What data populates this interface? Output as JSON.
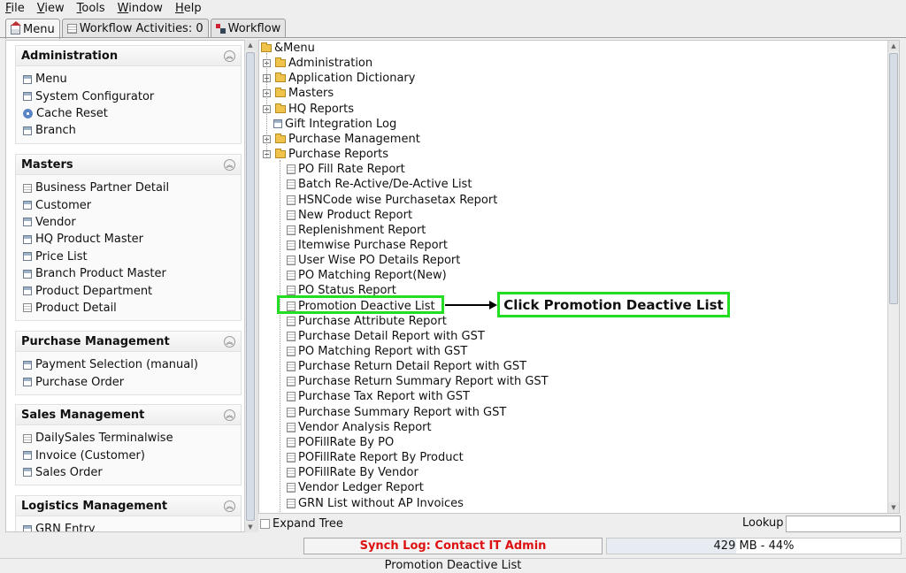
{
  "menubar": [
    "File",
    "View",
    "Tools",
    "Window",
    "Help"
  ],
  "tabs": [
    {
      "label": "Menu",
      "icon": "home-icon"
    },
    {
      "label": "Workflow Activities: 0",
      "icon": "grid-icon"
    },
    {
      "label": "Workflow",
      "icon": "workflow-icon"
    }
  ],
  "left": {
    "groups": [
      {
        "title": "Administration",
        "items": [
          {
            "label": "Menu",
            "icon": "window"
          },
          {
            "label": "System Configurator",
            "icon": "window"
          },
          {
            "label": "Cache Reset",
            "icon": "process"
          },
          {
            "label": "Branch",
            "icon": "window"
          }
        ]
      },
      {
        "title": "Masters",
        "items": [
          {
            "label": "Business Partner Detail",
            "icon": "report"
          },
          {
            "label": "Customer",
            "icon": "window"
          },
          {
            "label": "Vendor",
            "icon": "window"
          },
          {
            "label": "HQ Product Master",
            "icon": "window"
          },
          {
            "label": "Price List",
            "icon": "window"
          },
          {
            "label": "Branch Product Master",
            "icon": "window"
          },
          {
            "label": "Product Department",
            "icon": "window"
          },
          {
            "label": "Product Detail",
            "icon": "report"
          }
        ]
      },
      {
        "title": "Purchase Management",
        "items": [
          {
            "label": "Payment Selection (manual)",
            "icon": "window"
          },
          {
            "label": "Purchase Order",
            "icon": "window"
          }
        ]
      },
      {
        "title": "Sales Management",
        "items": [
          {
            "label": "DailySales Terminalwise",
            "icon": "report"
          },
          {
            "label": "Invoice (Customer)",
            "icon": "window"
          },
          {
            "label": "Sales Order",
            "icon": "window"
          }
        ]
      },
      {
        "title": "Logistics Management",
        "items": [
          {
            "label": "GRN Entry",
            "icon": "window"
          }
        ]
      }
    ]
  },
  "tree": {
    "root": "&Menu",
    "folders": [
      "Administration",
      "Application Dictionary",
      "Masters",
      "HQ Reports"
    ],
    "gift": "Gift Integration Log",
    "purchase_management": "Purchase Management",
    "purchase_reports": "Purchase Reports",
    "reports": [
      "PO Fill Rate Report",
      "Batch Re-Active/De-Active List",
      "HSNCode wise Purchasetax Report",
      "New Product Report",
      "Replenishment Report",
      "Itemwise Purchase Report",
      "User Wise PO Details Report",
      "PO Matching Report(New)",
      "PO Status Report",
      "Promotion Deactive List",
      "Purchase Attribute Report",
      "Purchase Detail Report with GST",
      "PO Matching Report with GST",
      "Purchase Return Detail Report with GST",
      "Purchase Return Summary Report with GST",
      "Purchase Tax Report with GST",
      "Purchase Summary Report with GST",
      "Vendor Analysis Report",
      "POFillRate By PO",
      "POFillRate Report By Product",
      "POFillRate By Vendor",
      "Vendor Ledger Report",
      "GRN List without AP Invoices"
    ]
  },
  "callout": "Click Promotion Deactive List",
  "footer": {
    "expand_tree": "Expand Tree",
    "lookup": "Lookup",
    "lookup_value": ""
  },
  "status": {
    "synch": "Synch Log: Contact IT Admin",
    "memory": "429 MB - 44%",
    "memory_fraction": 0.44,
    "message": "Promotion Deactive List"
  },
  "colors": {
    "highlight": "#22dd22",
    "synch_text": "#dd1111"
  }
}
